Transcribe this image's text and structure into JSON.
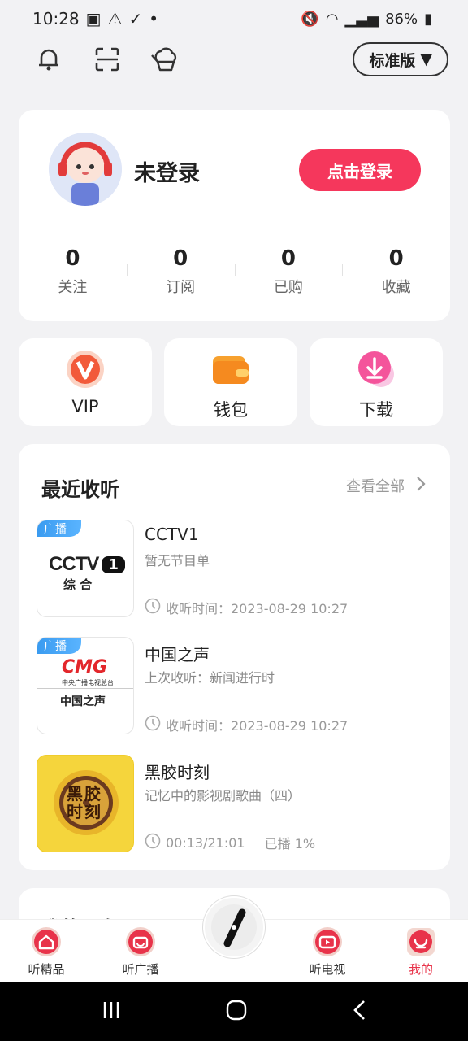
{
  "status": {
    "time": "10:28",
    "battery": "86%"
  },
  "top_bar": {
    "edition_label": "标准版"
  },
  "profile": {
    "name": "未登录",
    "login_button": "点击登录"
  },
  "stats": [
    {
      "value": "0",
      "label": "关注"
    },
    {
      "value": "0",
      "label": "订阅"
    },
    {
      "value": "0",
      "label": "已购"
    },
    {
      "value": "0",
      "label": "收藏"
    }
  ],
  "quick_actions": [
    {
      "label": "VIP",
      "icon": "vip-icon"
    },
    {
      "label": "钱包",
      "icon": "wallet-icon"
    },
    {
      "label": "下载",
      "icon": "download-icon"
    }
  ],
  "recent": {
    "title": "最近收听",
    "see_all": "查看全部",
    "items": [
      {
        "badge": "广播",
        "title": "CCTV1",
        "subtitle": "暂无节目单",
        "time": "收听时间：2023-08-29 10:27",
        "logo_text": "CCTV",
        "logo_num": "1",
        "logo_sub": "综 合"
      },
      {
        "badge": "广播",
        "title": "中国之声",
        "subtitle": "上次收听：新闻进行时",
        "time": "收听时间：2023-08-29 10:27",
        "logo_text": "CMG",
        "logo_small": "中央广播电视总台",
        "logo_sub": "中国之声"
      },
      {
        "title": "黑胶时刻",
        "subtitle": "记忆中的影视剧歌曲（四）",
        "time": "00:13/21:01",
        "played": "已播 1%",
        "logo_text": "黑胶时刻"
      }
    ]
  },
  "next_section": {
    "title": "我的服务"
  },
  "tabs": [
    {
      "label": "听精品",
      "icon": "home-icon"
    },
    {
      "label": "听广播",
      "icon": "radio-icon"
    },
    {
      "label": "听电视",
      "icon": "tv-icon"
    },
    {
      "label": "我的",
      "icon": "profile-icon"
    }
  ],
  "colors": {
    "accent": "#f5375c",
    "tab_active": "#e8334a",
    "badge": "#3a9bf0"
  }
}
